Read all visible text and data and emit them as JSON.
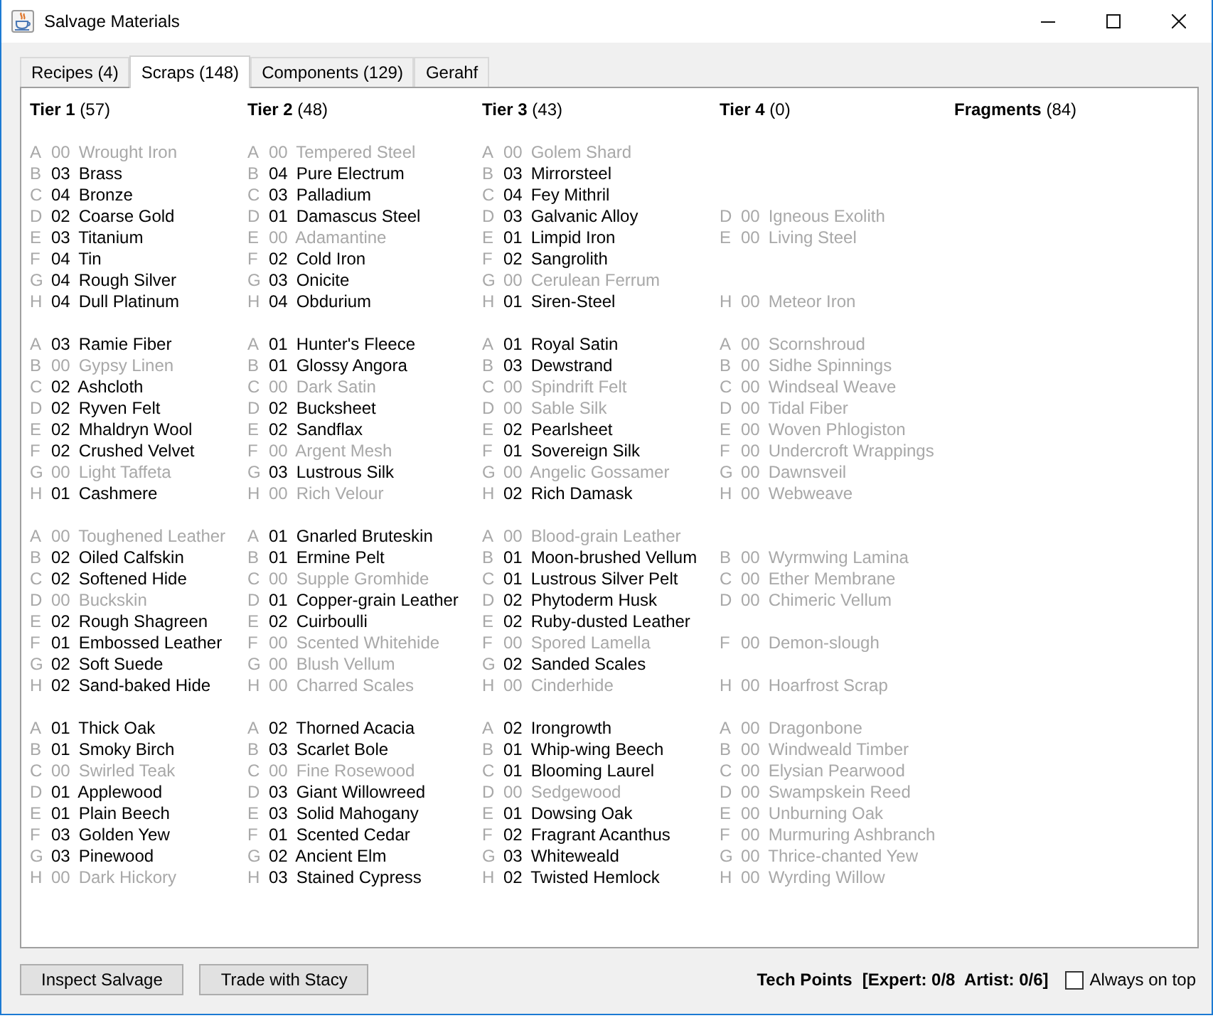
{
  "window": {
    "title": "Salvage Materials"
  },
  "tabs": [
    {
      "label": "Recipes (4)",
      "selected": false
    },
    {
      "label": "Scraps (148)",
      "selected": true
    },
    {
      "label": "Components (129)",
      "selected": false
    },
    {
      "label": "Gerahf",
      "selected": false
    }
  ],
  "columns": [
    {
      "heading": "**Tier 1** (57)",
      "groups": [
        [
          {
            "kind": "item",
            "letter": "A",
            "count": "00",
            "name": "Wrought Iron",
            "disabled": true
          },
          {
            "kind": "item",
            "letter": "B",
            "count": "03",
            "name": "Brass",
            "disabled": false
          },
          {
            "kind": "item",
            "letter": "C",
            "count": "04",
            "name": "Bronze",
            "disabled": false
          },
          {
            "kind": "item",
            "letter": "D",
            "count": "02",
            "name": "Coarse Gold",
            "disabled": false
          },
          {
            "kind": "item",
            "letter": "E",
            "count": "03",
            "name": "Titanium",
            "disabled": false
          },
          {
            "kind": "item",
            "letter": "F",
            "count": "04",
            "name": "Tin",
            "disabled": false
          },
          {
            "kind": "item",
            "letter": "G",
            "count": "04",
            "name": "Rough Silver",
            "disabled": false
          },
          {
            "kind": "item",
            "letter": "H",
            "count": "04",
            "name": "Dull Platinum",
            "disabled": false
          }
        ],
        [
          {
            "kind": "item",
            "letter": "A",
            "count": "03",
            "name": "Ramie Fiber",
            "disabled": false
          },
          {
            "kind": "item",
            "letter": "B",
            "count": "00",
            "name": "Gypsy Linen",
            "disabled": true
          },
          {
            "kind": "item",
            "letter": "C",
            "count": "02",
            "name": "Ashcloth",
            "disabled": false
          },
          {
            "kind": "item",
            "letter": "D",
            "count": "02",
            "name": "Ryven Felt",
            "disabled": false
          },
          {
            "kind": "item",
            "letter": "E",
            "count": "02",
            "name": "Mhaldryn Wool",
            "disabled": false
          },
          {
            "kind": "item",
            "letter": "F",
            "count": "02",
            "name": "Crushed Velvet",
            "disabled": false
          },
          {
            "kind": "item",
            "letter": "G",
            "count": "00",
            "name": "Light Taffeta",
            "disabled": true
          },
          {
            "kind": "item",
            "letter": "H",
            "count": "01",
            "name": "Cashmere",
            "disabled": false
          }
        ],
        [
          {
            "kind": "item",
            "letter": "A",
            "count": "00",
            "name": "Toughened Leather",
            "disabled": true
          },
          {
            "kind": "item",
            "letter": "B",
            "count": "02",
            "name": "Oiled Calfskin",
            "disabled": false
          },
          {
            "kind": "item",
            "letter": "C",
            "count": "02",
            "name": "Softened Hide",
            "disabled": false
          },
          {
            "kind": "item",
            "letter": "D",
            "count": "00",
            "name": "Buckskin",
            "disabled": true
          },
          {
            "kind": "item",
            "letter": "E",
            "count": "02",
            "name": "Rough Shagreen",
            "disabled": false
          },
          {
            "kind": "item",
            "letter": "F",
            "count": "01",
            "name": "Embossed Leather",
            "disabled": false
          },
          {
            "kind": "item",
            "letter": "G",
            "count": "02",
            "name": "Soft Suede",
            "disabled": false
          },
          {
            "kind": "item",
            "letter": "H",
            "count": "02",
            "name": "Sand-baked Hide",
            "disabled": false
          }
        ],
        [
          {
            "kind": "item",
            "letter": "A",
            "count": "01",
            "name": "Thick Oak",
            "disabled": false
          },
          {
            "kind": "item",
            "letter": "B",
            "count": "01",
            "name": "Smoky Birch",
            "disabled": false
          },
          {
            "kind": "item",
            "letter": "C",
            "count": "00",
            "name": "Swirled Teak",
            "disabled": true
          },
          {
            "kind": "item",
            "letter": "D",
            "count": "01",
            "name": "Applewood",
            "disabled": false
          },
          {
            "kind": "item",
            "letter": "E",
            "count": "01",
            "name": "Plain Beech",
            "disabled": false
          },
          {
            "kind": "item",
            "letter": "F",
            "count": "03",
            "name": "Golden Yew",
            "disabled": false
          },
          {
            "kind": "item",
            "letter": "G",
            "count": "03",
            "name": "Pinewood",
            "disabled": false
          },
          {
            "kind": "item",
            "letter": "H",
            "count": "00",
            "name": "Dark Hickory",
            "disabled": true
          }
        ]
      ]
    },
    {
      "heading": "**Tier 2** (48)",
      "groups": [
        [
          {
            "kind": "item",
            "letter": "A",
            "count": "00",
            "name": "Tempered Steel",
            "disabled": true
          },
          {
            "kind": "item",
            "letter": "B",
            "count": "04",
            "name": "Pure Electrum",
            "disabled": false
          },
          {
            "kind": "item",
            "letter": "C",
            "count": "03",
            "name": "Palladium",
            "disabled": false
          },
          {
            "kind": "item",
            "letter": "D",
            "count": "01",
            "name": "Damascus Steel",
            "disabled": false
          },
          {
            "kind": "item",
            "letter": "E",
            "count": "00",
            "name": "Adamantine",
            "disabled": true
          },
          {
            "kind": "item",
            "letter": "F",
            "count": "02",
            "name": "Cold Iron",
            "disabled": false
          },
          {
            "kind": "item",
            "letter": "G",
            "count": "03",
            "name": "Onicite",
            "disabled": false
          },
          {
            "kind": "item",
            "letter": "H",
            "count": "04",
            "name": "Obdurium",
            "disabled": false
          }
        ],
        [
          {
            "kind": "item",
            "letter": "A",
            "count": "01",
            "name": "Hunter's Fleece",
            "disabled": false
          },
          {
            "kind": "item",
            "letter": "B",
            "count": "01",
            "name": "Glossy Angora",
            "disabled": false
          },
          {
            "kind": "item",
            "letter": "C",
            "count": "00",
            "name": "Dark Satin",
            "disabled": true
          },
          {
            "kind": "item",
            "letter": "D",
            "count": "02",
            "name": "Bucksheet",
            "disabled": false
          },
          {
            "kind": "item",
            "letter": "E",
            "count": "02",
            "name": "Sandflax",
            "disabled": false
          },
          {
            "kind": "item",
            "letter": "F",
            "count": "00",
            "name": "Argent Mesh",
            "disabled": true
          },
          {
            "kind": "item",
            "letter": "G",
            "count": "03",
            "name": "Lustrous Silk",
            "disabled": false
          },
          {
            "kind": "item",
            "letter": "H",
            "count": "00",
            "name": "Rich Velour",
            "disabled": true
          }
        ],
        [
          {
            "kind": "item",
            "letter": "A",
            "count": "01",
            "name": "Gnarled Bruteskin",
            "disabled": false
          },
          {
            "kind": "item",
            "letter": "B",
            "count": "01",
            "name": "Ermine Pelt",
            "disabled": false
          },
          {
            "kind": "item",
            "letter": "C",
            "count": "00",
            "name": "Supple Gromhide",
            "disabled": true
          },
          {
            "kind": "item",
            "letter": "D",
            "count": "01",
            "name": "Copper-grain Leather",
            "disabled": false
          },
          {
            "kind": "item",
            "letter": "E",
            "count": "02",
            "name": "Cuirboulli",
            "disabled": false
          },
          {
            "kind": "item",
            "letter": "F",
            "count": "00",
            "name": "Scented Whitehide",
            "disabled": true
          },
          {
            "kind": "item",
            "letter": "G",
            "count": "00",
            "name": "Blush Vellum",
            "disabled": true
          },
          {
            "kind": "item",
            "letter": "H",
            "count": "00",
            "name": "Charred Scales",
            "disabled": true
          }
        ],
        [
          {
            "kind": "item",
            "letter": "A",
            "count": "02",
            "name": "Thorned Acacia",
            "disabled": false
          },
          {
            "kind": "item",
            "letter": "B",
            "count": "03",
            "name": "Scarlet Bole",
            "disabled": false
          },
          {
            "kind": "item",
            "letter": "C",
            "count": "00",
            "name": "Fine Rosewood",
            "disabled": true
          },
          {
            "kind": "item",
            "letter": "D",
            "count": "03",
            "name": "Giant Willowreed",
            "disabled": false
          },
          {
            "kind": "item",
            "letter": "E",
            "count": "03",
            "name": "Solid Mahogany",
            "disabled": false
          },
          {
            "kind": "item",
            "letter": "F",
            "count": "01",
            "name": "Scented Cedar",
            "disabled": false
          },
          {
            "kind": "item",
            "letter": "G",
            "count": "02",
            "name": "Ancient Elm",
            "disabled": false
          },
          {
            "kind": "item",
            "letter": "H",
            "count": "03",
            "name": "Stained Cypress",
            "disabled": false
          }
        ]
      ]
    },
    {
      "heading": "**Tier 3** (43)",
      "groups": [
        [
          {
            "kind": "item",
            "letter": "A",
            "count": "00",
            "name": "Golem Shard",
            "disabled": true
          },
          {
            "kind": "item",
            "letter": "B",
            "count": "03",
            "name": "Mirrorsteel",
            "disabled": false
          },
          {
            "kind": "item",
            "letter": "C",
            "count": "04",
            "name": "Fey Mithril",
            "disabled": false
          },
          {
            "kind": "item",
            "letter": "D",
            "count": "03",
            "name": "Galvanic Alloy",
            "disabled": false
          },
          {
            "kind": "item",
            "letter": "E",
            "count": "01",
            "name": "Limpid Iron",
            "disabled": false
          },
          {
            "kind": "item",
            "letter": "F",
            "count": "02",
            "name": "Sangrolith",
            "disabled": false
          },
          {
            "kind": "item",
            "letter": "G",
            "count": "00",
            "name": "Cerulean Ferrum",
            "disabled": true
          },
          {
            "kind": "item",
            "letter": "H",
            "count": "01",
            "name": "Siren-Steel",
            "disabled": false
          }
        ],
        [
          {
            "kind": "item",
            "letter": "A",
            "count": "01",
            "name": "Royal Satin",
            "disabled": false
          },
          {
            "kind": "item",
            "letter": "B",
            "count": "03",
            "name": "Dewstrand",
            "disabled": false
          },
          {
            "kind": "item",
            "letter": "C",
            "count": "00",
            "name": "Spindrift Felt",
            "disabled": true
          },
          {
            "kind": "item",
            "letter": "D",
            "count": "00",
            "name": "Sable Silk",
            "disabled": true
          },
          {
            "kind": "item",
            "letter": "E",
            "count": "02",
            "name": "Pearlsheet",
            "disabled": false
          },
          {
            "kind": "item",
            "letter": "F",
            "count": "01",
            "name": "Sovereign Silk",
            "disabled": false
          },
          {
            "kind": "item",
            "letter": "G",
            "count": "00",
            "name": "Angelic Gossamer",
            "disabled": true
          },
          {
            "kind": "item",
            "letter": "H",
            "count": "02",
            "name": "Rich Damask",
            "disabled": false
          }
        ],
        [
          {
            "kind": "item",
            "letter": "A",
            "count": "00",
            "name": "Blood-grain Leather",
            "disabled": true
          },
          {
            "kind": "item",
            "letter": "B",
            "count": "01",
            "name": "Moon-brushed Vellum",
            "disabled": false
          },
          {
            "kind": "item",
            "letter": "C",
            "count": "01",
            "name": "Lustrous Silver Pelt",
            "disabled": false
          },
          {
            "kind": "item",
            "letter": "D",
            "count": "02",
            "name": "Phytoderm Husk",
            "disabled": false
          },
          {
            "kind": "item",
            "letter": "E",
            "count": "02",
            "name": "Ruby-dusted Leather",
            "disabled": false
          },
          {
            "kind": "item",
            "letter": "F",
            "count": "00",
            "name": "Spored Lamella",
            "disabled": true
          },
          {
            "kind": "item",
            "letter": "G",
            "count": "02",
            "name": "Sanded Scales",
            "disabled": false
          },
          {
            "kind": "item",
            "letter": "H",
            "count": "00",
            "name": "Cinderhide",
            "disabled": true
          }
        ],
        [
          {
            "kind": "item",
            "letter": "A",
            "count": "02",
            "name": "Irongrowth",
            "disabled": false
          },
          {
            "kind": "item",
            "letter": "B",
            "count": "01",
            "name": "Whip-wing Beech",
            "disabled": false
          },
          {
            "kind": "item",
            "letter": "C",
            "count": "01",
            "name": "Blooming Laurel",
            "disabled": false
          },
          {
            "kind": "item",
            "letter": "D",
            "count": "00",
            "name": "Sedgewood",
            "disabled": true
          },
          {
            "kind": "item",
            "letter": "E",
            "count": "01",
            "name": "Dowsing Oak",
            "disabled": false
          },
          {
            "kind": "item",
            "letter": "F",
            "count": "02",
            "name": "Fragrant Acanthus",
            "disabled": false
          },
          {
            "kind": "item",
            "letter": "G",
            "count": "03",
            "name": "Whiteweald",
            "disabled": false
          },
          {
            "kind": "item",
            "letter": "H",
            "count": "02",
            "name": "Twisted Hemlock",
            "disabled": false
          }
        ]
      ]
    },
    {
      "heading": "**Tier 4** (0)",
      "groups": [
        [
          {
            "kind": "gap"
          },
          {
            "kind": "gap"
          },
          {
            "kind": "gap"
          },
          {
            "kind": "item",
            "letter": "D",
            "count": "00",
            "name": "Igneous Exolith",
            "disabled": true
          },
          {
            "kind": "item",
            "letter": "E",
            "count": "00",
            "name": "Living Steel",
            "disabled": true
          },
          {
            "kind": "gap"
          },
          {
            "kind": "gap"
          },
          {
            "kind": "item",
            "letter": "H",
            "count": "00",
            "name": "Meteor Iron",
            "disabled": true
          }
        ],
        [
          {
            "kind": "item",
            "letter": "A",
            "count": "00",
            "name": "Scornshroud",
            "disabled": true
          },
          {
            "kind": "item",
            "letter": "B",
            "count": "00",
            "name": "Sidhe Spinnings",
            "disabled": true
          },
          {
            "kind": "item",
            "letter": "C",
            "count": "00",
            "name": "Windseal Weave",
            "disabled": true
          },
          {
            "kind": "item",
            "letter": "D",
            "count": "00",
            "name": "Tidal Fiber",
            "disabled": true
          },
          {
            "kind": "item",
            "letter": "E",
            "count": "00",
            "name": "Woven Phlogiston",
            "disabled": true
          },
          {
            "kind": "item",
            "letter": "F",
            "count": "00",
            "name": "Undercroft Wrappings",
            "disabled": true
          },
          {
            "kind": "item",
            "letter": "G",
            "count": "00",
            "name": "Dawnsveil",
            "disabled": true
          },
          {
            "kind": "item",
            "letter": "H",
            "count": "00",
            "name": "Webweave",
            "disabled": true
          }
        ],
        [
          {
            "kind": "gap"
          },
          {
            "kind": "item",
            "letter": "B",
            "count": "00",
            "name": "Wyrmwing Lamina",
            "disabled": true
          },
          {
            "kind": "item",
            "letter": "C",
            "count": "00",
            "name": "Ether Membrane",
            "disabled": true
          },
          {
            "kind": "item",
            "letter": "D",
            "count": "00",
            "name": "Chimeric Vellum",
            "disabled": true
          },
          {
            "kind": "gap"
          },
          {
            "kind": "item",
            "letter": "F",
            "count": "00",
            "name": "Demon-slough",
            "disabled": true
          },
          {
            "kind": "gap"
          },
          {
            "kind": "item",
            "letter": "H",
            "count": "00",
            "name": "Hoarfrost Scrap",
            "disabled": true
          }
        ],
        [
          {
            "kind": "item",
            "letter": "A",
            "count": "00",
            "name": "Dragonbone",
            "disabled": true
          },
          {
            "kind": "item",
            "letter": "B",
            "count": "00",
            "name": "Windweald Timber",
            "disabled": true
          },
          {
            "kind": "item",
            "letter": "C",
            "count": "00",
            "name": "Elysian Pearwood",
            "disabled": true
          },
          {
            "kind": "item",
            "letter": "D",
            "count": "00",
            "name": "Swampskein Reed",
            "disabled": true
          },
          {
            "kind": "item",
            "letter": "E",
            "count": "00",
            "name": "Unburning Oak",
            "disabled": true
          },
          {
            "kind": "item",
            "letter": "F",
            "count": "00",
            "name": "Murmuring Ashbranch",
            "disabled": true
          },
          {
            "kind": "item",
            "letter": "G",
            "count": "00",
            "name": "Thrice-chanted Yew",
            "disabled": true
          },
          {
            "kind": "item",
            "letter": "H",
            "count": "00",
            "name": "Wyrding Willow",
            "disabled": true
          }
        ]
      ]
    },
    {
      "heading": "**Fragments** (84)"
    }
  ],
  "buttons": [
    {
      "label": "Inspect Salvage"
    },
    {
      "label": "Trade with Stacy"
    }
  ],
  "tech_points": {
    "label": "Tech Points",
    "value": "[Expert: 0/8  Artist: 0/6]"
  },
  "always_on_top": {
    "label": "Always on top",
    "checked": false
  }
}
